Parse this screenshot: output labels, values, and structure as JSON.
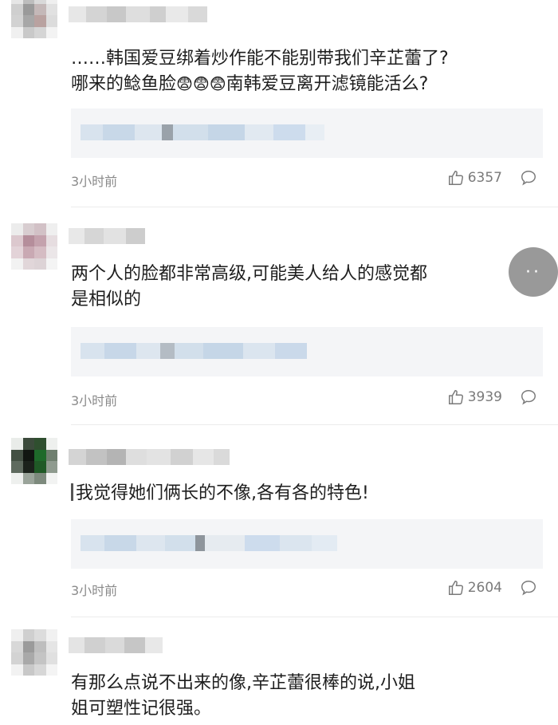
{
  "comments": [
    {
      "text_line1": "……韩国爱豆绑着炒作能不能别带我们辛芷蕾了?",
      "text_line2_prefix": "哪来的鲶鱼脸",
      "emoji": "😨😨😨",
      "text_line2_suffix": "南韩爱豆离开滤镜能活么?",
      "time": "3小时前",
      "likes": "6357"
    },
    {
      "text_line1": "两个人的脸都非常高级,可能美人给人的感觉都",
      "text_line2": "是相似的",
      "time": "3小时前",
      "likes": "3939"
    },
    {
      "text_line1": "我觉得她们俩长的不像,各有各的特色!",
      "time": "3小时前",
      "likes": "2604"
    },
    {
      "text_line1": "有那么点说不出来的像,辛芷蕾很棒的说,小姐",
      "text_line2": "姐可塑性记很强。"
    }
  ],
  "icons": {
    "like": "thumbs-up-icon",
    "reply": "comment-bubble-icon",
    "more": "more-dots-icon"
  },
  "more_button_label": "··",
  "colors": {
    "quote_bg": "#f4f5f7",
    "meta_text": "#8a8a8a",
    "pixelated_blue": "#cfe0f0"
  }
}
